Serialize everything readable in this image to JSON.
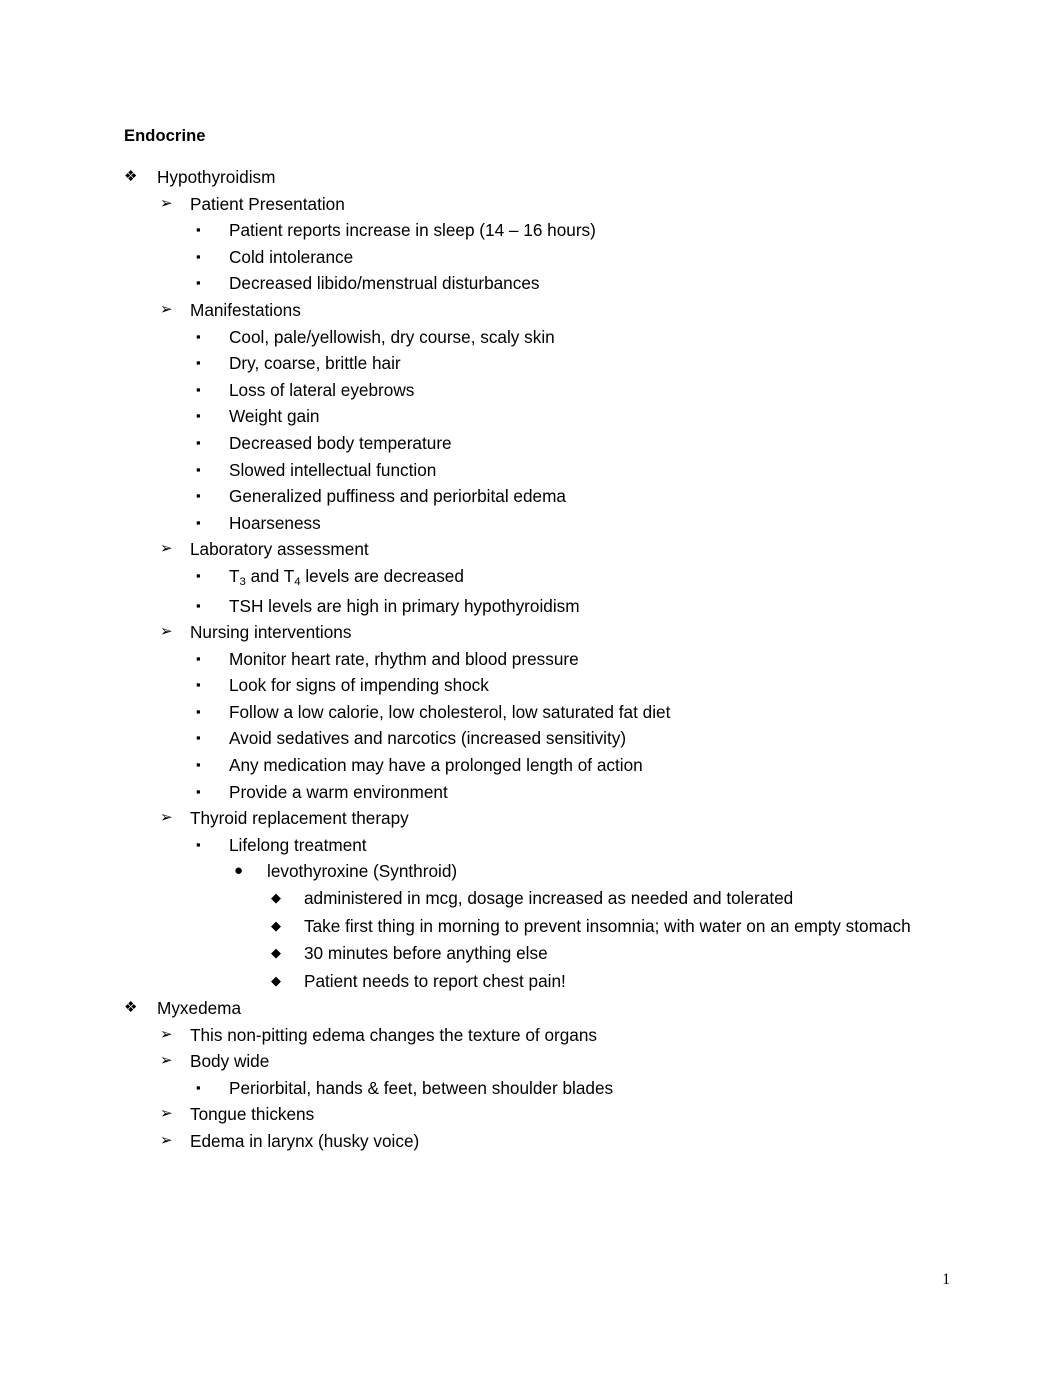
{
  "document": {
    "title": "Endocrine",
    "page_number": "1",
    "bullets": {
      "level1": "❖",
      "level2": "➢",
      "level3": "▪",
      "level4": "●",
      "level5": "◆"
    },
    "outline": [
      {
        "level": 1,
        "text": "Hypothyroidism"
      },
      {
        "level": 2,
        "text": "Patient Presentation"
      },
      {
        "level": 3,
        "text": "Patient reports increase in sleep (14 – 16 hours)"
      },
      {
        "level": 3,
        "text": "Cold intolerance"
      },
      {
        "level": 3,
        "text": "Decreased libido/menstrual disturbances"
      },
      {
        "level": 2,
        "text": "Manifestations"
      },
      {
        "level": 3,
        "text": "Cool, pale/yellowish, dry course, scaly skin"
      },
      {
        "level": 3,
        "text": "Dry, coarse, brittle hair"
      },
      {
        "level": 3,
        "text": "Loss of lateral eyebrows"
      },
      {
        "level": 3,
        "text": "Weight gain"
      },
      {
        "level": 3,
        "text": "Decreased body temperature"
      },
      {
        "level": 3,
        "text": "Slowed intellectual function"
      },
      {
        "level": 3,
        "text": "Generalized puffiness and periorbital edema"
      },
      {
        "level": 3,
        "text": "Hoarseness"
      },
      {
        "level": 2,
        "text": "Laboratory assessment"
      },
      {
        "level": 3,
        "text": "T3 and T4 levels are decreased",
        "html": "T<sub>3</sub> and T<sub>4</sub> levels are decreased"
      },
      {
        "level": 3,
        "text": "TSH levels are high in primary hypothyroidism"
      },
      {
        "level": 2,
        "text": "Nursing interventions"
      },
      {
        "level": 3,
        "text": "Monitor heart rate, rhythm and blood pressure"
      },
      {
        "level": 3,
        "text": "Look for signs of impending shock"
      },
      {
        "level": 3,
        "text": "Follow a low calorie, low cholesterol, low saturated fat diet"
      },
      {
        "level": 3,
        "text": "Avoid sedatives and narcotics (increased sensitivity)"
      },
      {
        "level": 3,
        "text": "Any medication may have a prolonged length of action"
      },
      {
        "level": 3,
        "text": "Provide a warm environment"
      },
      {
        "level": 2,
        "text": "Thyroid replacement therapy"
      },
      {
        "level": 3,
        "text": "Lifelong treatment"
      },
      {
        "level": 4,
        "text": "levothyroxine (Synthroid)"
      },
      {
        "level": 5,
        "text": "administered in mcg, dosage increased as needed and tolerated"
      },
      {
        "level": 5,
        "text": "Take first thing in morning to prevent insomnia; with water on an empty stomach"
      },
      {
        "level": 5,
        "text": "30 minutes before anything else"
      },
      {
        "level": 5,
        "text": "Patient needs to report chest pain!"
      },
      {
        "level": 1,
        "text": "Myxedema"
      },
      {
        "level": 2,
        "text": "This non-pitting edema changes the texture of organs"
      },
      {
        "level": 2,
        "text": "Body wide"
      },
      {
        "level": 3,
        "text": "Periorbital, hands & feet, between shoulder blades"
      },
      {
        "level": 2,
        "text": "Tongue thickens"
      },
      {
        "level": 2,
        "text": "Edema in larynx (husky voice)"
      }
    ]
  }
}
